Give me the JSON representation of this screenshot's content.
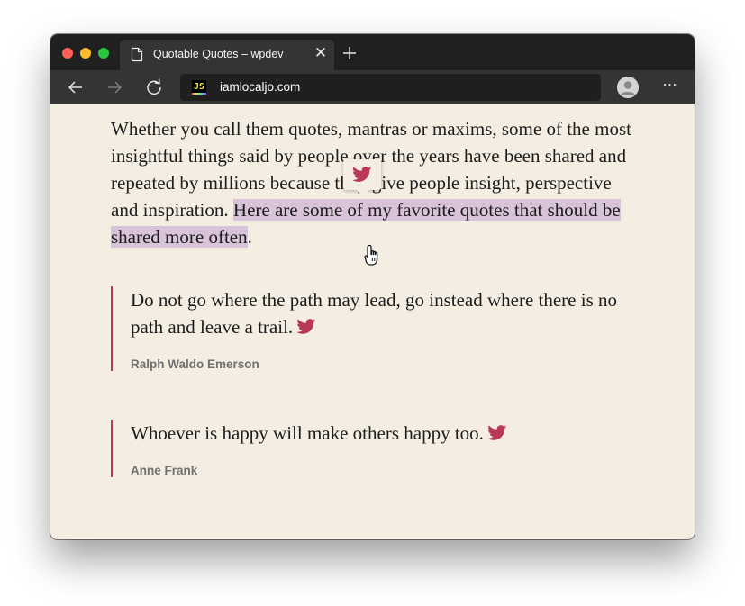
{
  "browser": {
    "tab_title": "Quotable Quotes – wpdev",
    "tab_close": "✕",
    "url": "iamlocaljo.com",
    "favicon_text": "JS",
    "menu": "⋯",
    "traffic_lights": [
      "#fe5f57",
      "#febc2e",
      "#28c840"
    ]
  },
  "intro": {
    "text": "Whether you call them quotes, mantras or maxims, some of the most insightful things said by people over the years have been shared and repeated by millions because they give people insight, perspective and inspiration. ",
    "highlighted": "Here are some of my favorite quotes that should be shared more often",
    "end": ".",
    "highlight_color": "#d8c3d8"
  },
  "tweet_popup": {
    "icon": "twitter-bird-icon"
  },
  "quotes": [
    {
      "text": "Do not go where the path may lead, go instead where there is no path and leave a trail.",
      "author": "Ralph Waldo Emerson"
    },
    {
      "text": "Whoever is happy will make others happy too.",
      "author": "Anne Frank"
    }
  ],
  "colors": {
    "accent": "#b83956",
    "background": "#f4ede2",
    "author": "#717171"
  }
}
